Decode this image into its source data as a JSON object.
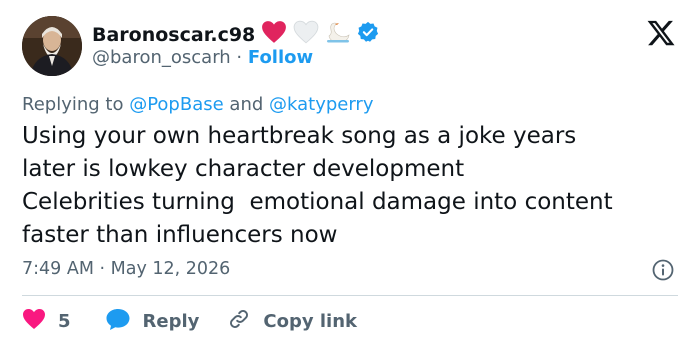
{
  "author": {
    "display_name": "Baronoscar.c98",
    "handle": "@baron_oscarh",
    "separator": " · ",
    "follow_label": "Follow",
    "verified": true
  },
  "reply_context": {
    "prefix": "Replying to ",
    "user1": "@PopBase",
    "connector": " and ",
    "user2": "@katyperry"
  },
  "tweet": {
    "lines": [
      "Using your own heartbreak song as a joke years",
      "later is lowkey character development",
      "Celebrities turning  emotional damage into content",
      "faster than influencers now"
    ]
  },
  "timestamp": "7:49 AM · May 12, 2026",
  "actions": {
    "like_count": "5",
    "reply_label": "Reply",
    "copy_link_label": "Copy link"
  },
  "icons": {
    "logo": "x-logo-icon",
    "verified": "verified-badge-icon",
    "info": "info-icon",
    "like": "heart-icon",
    "reply": "reply-bubble-icon",
    "copy": "link-icon"
  },
  "colors": {
    "accent": "#1d9bf0",
    "heart": "#f91880",
    "muted": "#536471",
    "text": "#0f1419"
  }
}
